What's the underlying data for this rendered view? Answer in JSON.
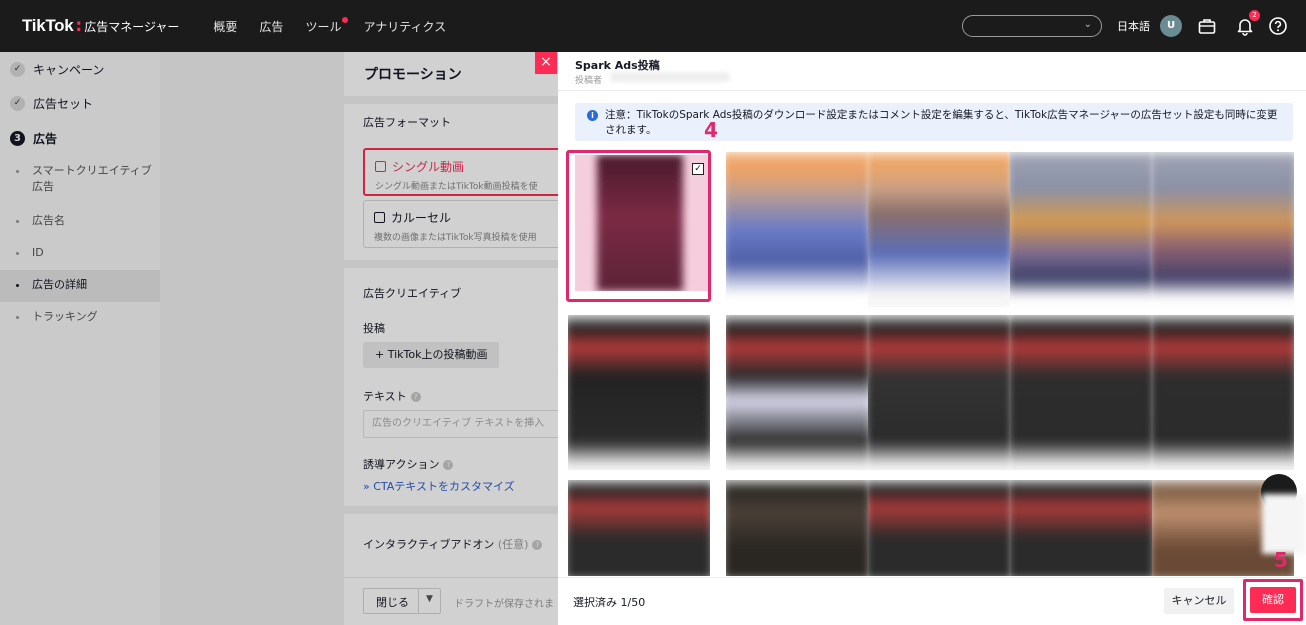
{
  "topbar": {
    "brand": "TikTok",
    "brand_separator": ":",
    "brand_sub": "広告マネージャー",
    "nav": [
      "概要",
      "広告",
      "ツール",
      "アナリティクス"
    ],
    "language": "日本語",
    "avatar_initial": "U",
    "notification_count": "2",
    "account_chevron": "⌄"
  },
  "sidebar": {
    "steps": [
      {
        "label": "キャンペーン",
        "state": "done",
        "marker": "✓"
      },
      {
        "label": "広告セット",
        "state": "done",
        "marker": "✓"
      },
      {
        "label": "広告",
        "state": "current",
        "marker": "3"
      }
    ],
    "sub_items": [
      {
        "label": "スマートクリエイティブ広告"
      },
      {
        "label": "広告名"
      },
      {
        "label": "ID"
      },
      {
        "label": "広告の詳細",
        "active": true
      },
      {
        "label": "トラッキング"
      }
    ]
  },
  "form": {
    "title": "プロモーション",
    "ad_format_label": "広告フォーマット",
    "format_single_title": "シングル動画",
    "format_single_desc": "シングル動画またはTikTok動画投稿を使",
    "format_carousel_title": "カルーセル",
    "format_carousel_desc": "複数の画像またはTikTok写真投稿を使用",
    "creative_label": "広告クリエイティブ",
    "post_label": "投稿",
    "post_button": "+ TikTok上の投稿動画",
    "text_label": "テキスト",
    "text_placeholder": "広告のクリエイティブ テキストを挿入",
    "cta_label": "誘導アクション",
    "cta_link": "» CTAテキストをカスタマイズ",
    "interactive_label": "インタラクティブアドオン",
    "interactive_optional": "(任意)",
    "close_button": "閉じる",
    "draft_text": "ドラフトが保存されま"
  },
  "panel": {
    "title": "Spark Ads投稿",
    "subtitle": "投稿者",
    "notice": "注意：TikTokのSpark Ads投稿のダウンロード設定またはコメント設定を編集すると、TikTok広告マネージャーの広告セット設定も同時に変更されます。",
    "selected_count": "選択済み 1/50",
    "cancel_button": "キャンセル",
    "confirm_button": "確認",
    "close_icon": "×"
  },
  "annotations": {
    "step4": "4",
    "step5": "5"
  },
  "colors": {
    "accent": "#fe2c55",
    "highlight": "#e0286a",
    "topbar": "#1b1b1b",
    "link": "#2b5fd0"
  }
}
